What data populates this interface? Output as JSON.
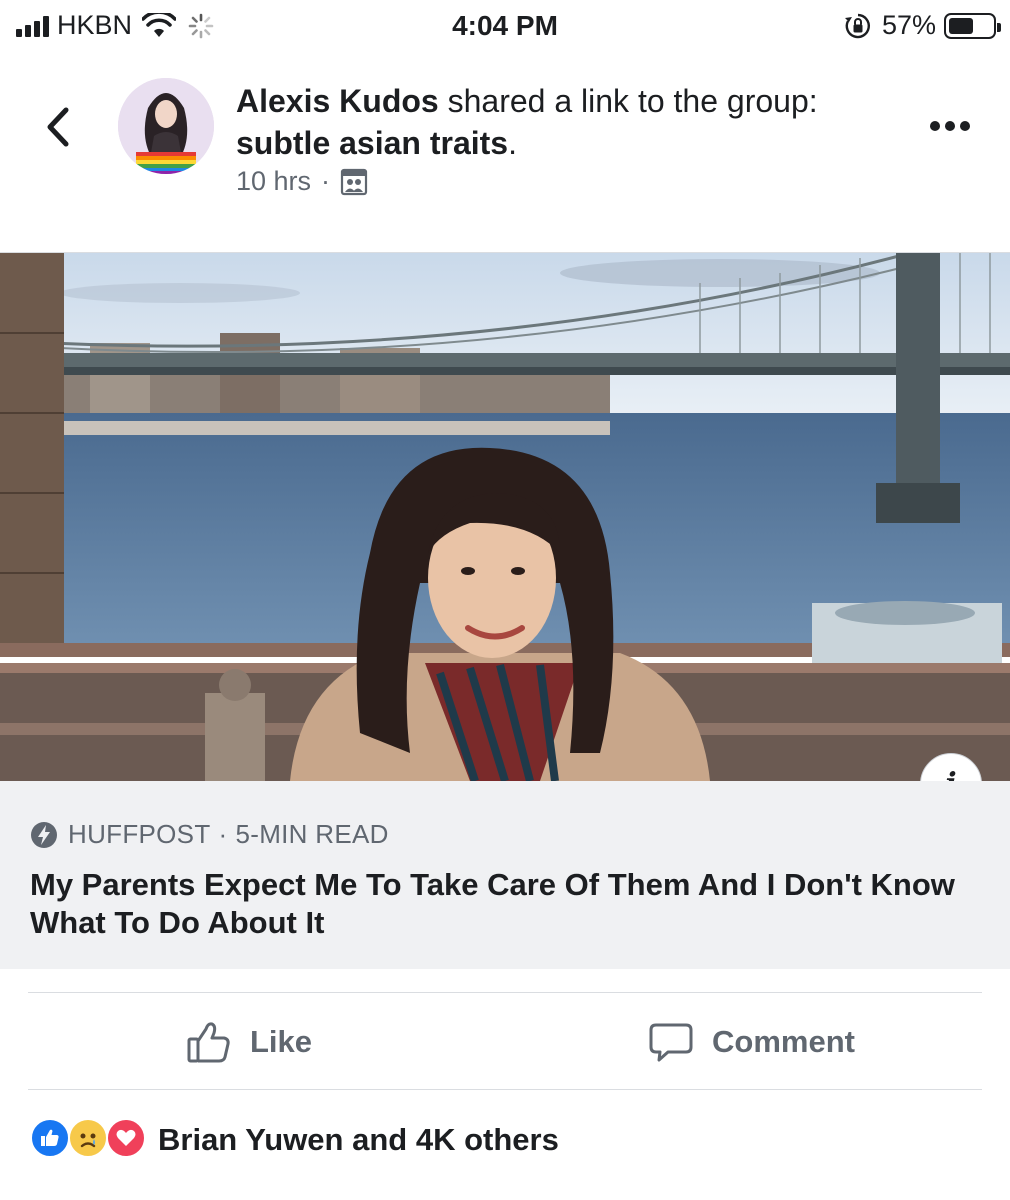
{
  "status_bar": {
    "carrier": "HKBN",
    "time": "4:04 PM",
    "battery_percent": "57%",
    "battery_level": 0.57,
    "icons": [
      "signal-icon",
      "wifi-icon",
      "activity-spinner-icon",
      "orientation-lock-icon",
      "battery-icon"
    ]
  },
  "post": {
    "author": "Alexis Kudos",
    "action_text": " shared a link to the group: ",
    "group_name": "subtle asian traits",
    "group_suffix": ".",
    "timestamp": "10 hrs",
    "separator": "·",
    "privacy_icon": "group-icon"
  },
  "link": {
    "source": "HUFFPOST",
    "separator": "·",
    "read_time": "5-MIN READ",
    "title": "My Parents Expect Me To Take Care Of Them And I Don't Know What To Do About It",
    "info_label": "i"
  },
  "actions": {
    "like_label": "Like",
    "comment_label": "Comment"
  },
  "reactions": {
    "types": [
      "like",
      "sad",
      "love"
    ],
    "summary": "Brian Yuwen and 4K others"
  },
  "colors": {
    "text_primary": "#1c1e21",
    "text_secondary": "#606770",
    "card_bg": "#f0f1f3",
    "like_blue": "#1877f2",
    "love_red": "#f0405a",
    "sad_yellow": "#f7c94a"
  }
}
